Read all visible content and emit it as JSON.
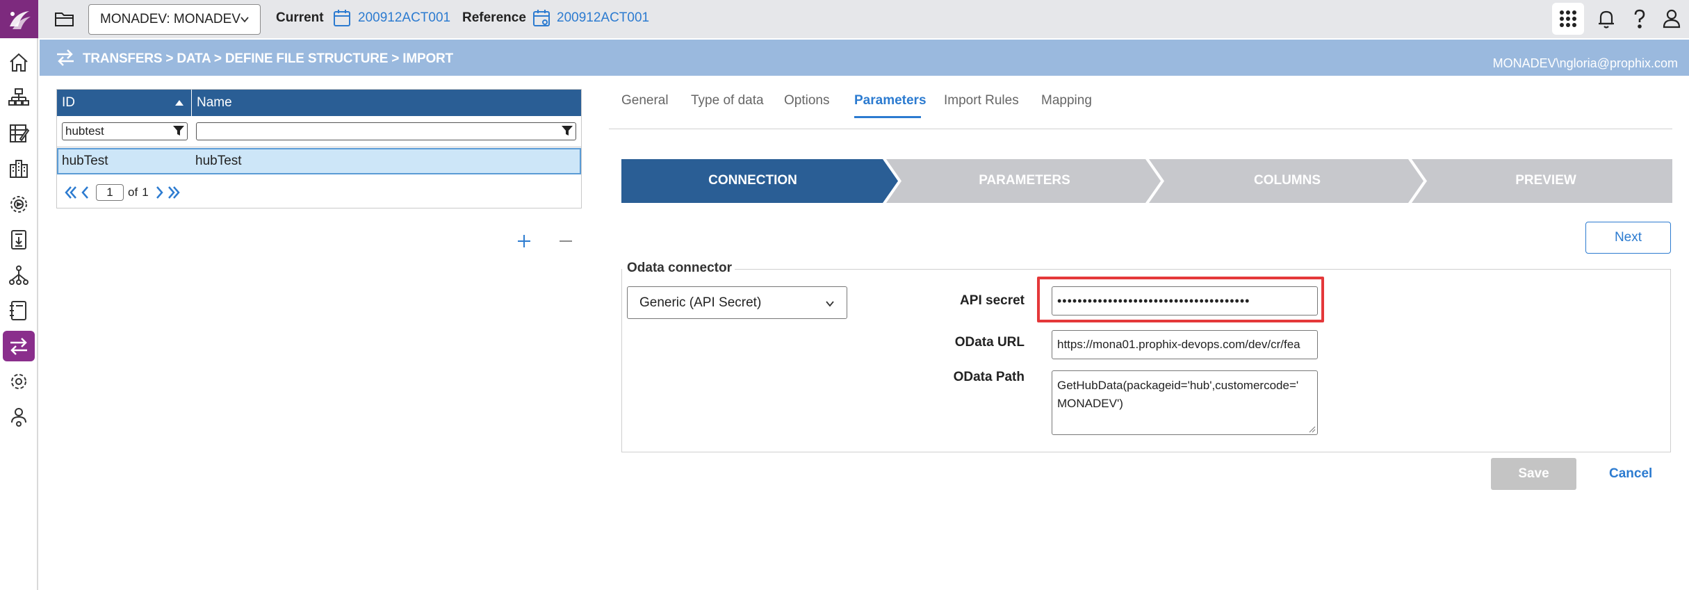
{
  "topbar": {
    "environment": "MONADEV: MONADEV",
    "current_label": "Current",
    "current_value": "200912ACT001",
    "reference_label": "Reference",
    "reference_value": "200912ACT001"
  },
  "breadcrumb": {
    "path": "TRANSFERS > DATA > DEFINE FILE STRUCTURE > IMPORT",
    "user": "MONADEV\\ngloria@prophix.com"
  },
  "grid": {
    "columns": [
      "ID",
      "Name"
    ],
    "filter_id": "hubtest",
    "filter_name": "",
    "rows": [
      {
        "id": "hubTest",
        "name": "hubTest"
      }
    ],
    "pager": {
      "page": "1",
      "of_label": "of",
      "total": "1"
    }
  },
  "tabs": [
    "General",
    "Type of data",
    "Options",
    "Parameters",
    "Import Rules",
    "Mapping"
  ],
  "active_tab": "Parameters",
  "steps": [
    "CONNECTION",
    "PARAMETERS",
    "COLUMNS",
    "PREVIEW"
  ],
  "next_label": "Next",
  "form": {
    "legend": "Odata connector",
    "connector_value": "Generic (API Secret)",
    "api_secret_label": "API secret",
    "api_secret_value": "••••••••••••••••••••••••••••••••••••••",
    "odata_url_label": "OData URL",
    "odata_url_value": "https://mona01.prophix-devops.com/dev/cr/fea",
    "odata_path_label": "OData Path",
    "odata_path_line1": "GetHubData(packageid='hub',customercode='",
    "odata_path_line2": "MONADEV')"
  },
  "actions": {
    "save": "Save",
    "cancel": "Cancel"
  },
  "colors": {
    "accent": "#2c7bd0",
    "brand": "#7d2a7e",
    "header": "#2a5e95",
    "breadcrumb_bg": "#9ab9de",
    "highlight": "#e4383a"
  }
}
